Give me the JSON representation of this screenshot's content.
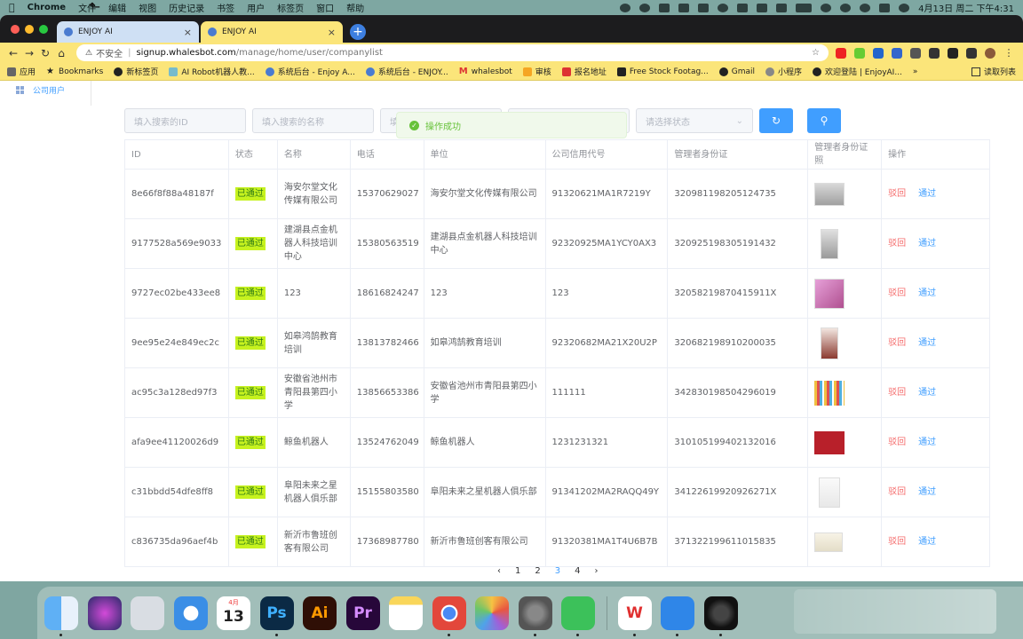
{
  "menubar": {
    "app": "Chrome",
    "items": [
      "文件",
      "编辑",
      "视图",
      "历史记录",
      "书签",
      "用户",
      "标签页",
      "窗口",
      "帮助"
    ],
    "clock": "4月13日 周二 下午4:31"
  },
  "tabs": [
    {
      "title": "ENJOY AI",
      "close": "×"
    },
    {
      "title": "ENJOY AI",
      "close": "×"
    }
  ],
  "newtab": "+",
  "address": {
    "insecure": "不安全",
    "separator": "|",
    "host": "signup.whalesbot.com",
    "path": "/manage/home/user/companylist"
  },
  "bookmarks": [
    "应用",
    "Bookmarks",
    "新标签页",
    "AI Robot机器人教...",
    "系统后台 - Enjoy A...",
    "系统后台 - ENJOY...",
    "whalesbot",
    "审核",
    "报名地址",
    "Free Stock Footag...",
    "Gmail",
    "小程序",
    "欢迎登陆 | EnjoyAI..."
  ],
  "bookmarks_more": "»",
  "reading_list": "读取列表",
  "sidebar": {
    "item": "公司用户"
  },
  "filters": {
    "id_placeholder": "填入搜索的ID",
    "name_placeholder": "填入搜索的名称",
    "third_placeholder": "填",
    "status_placeholder": "请选择状态"
  },
  "toast": {
    "message": "操作成功",
    "color": "#67c23a"
  },
  "table": {
    "headers": [
      "ID",
      "状态",
      "名称",
      "电话",
      "单位",
      "公司信用代号",
      "管理者身份证",
      "管理者身份证照",
      "操作"
    ],
    "rows": [
      {
        "id": "8e66f8f88a48187f",
        "status": "已通过",
        "name": "海安尔堂文化传媒有限公司",
        "phone": "15370629027",
        "unit": "海安尔堂文化传媒有限公司",
        "credit": "91320621MA1R7219Y",
        "idcard": "320981198205124735",
        "reject": "驳回",
        "pass": "通过"
      },
      {
        "id": "9177528a569e9033",
        "status": "已通过",
        "name": "建湖县点金机器人科技培训中心",
        "phone": "15380563519",
        "unit": "建湖县点金机器人科技培训中心",
        "credit": "92320925MA1YCY0AX3",
        "idcard": "320925198305191432",
        "reject": "驳回",
        "pass": "通过"
      },
      {
        "id": "9727ec02be433ee8",
        "status": "已通过",
        "name": "123",
        "phone": "18616824247",
        "unit": "123",
        "credit": "123",
        "idcard": "32058219870415911X",
        "reject": "驳回",
        "pass": "通过"
      },
      {
        "id": "9ee95e24e849ec2c",
        "status": "已通过",
        "name": "如皋鸿鹄教育培训",
        "phone": "13813782466",
        "unit": "如皋鸿鹄教育培训",
        "credit": "92320682MA21X20U2P",
        "idcard": "320682198910200035",
        "reject": "驳回",
        "pass": "通过"
      },
      {
        "id": "ac95c3a128ed97f3",
        "status": "已通过",
        "name": "安徽省池州市青阳县第四小学",
        "phone": "13856653386",
        "unit": "安徽省池州市青阳县第四小学",
        "credit": "111111",
        "idcard": "342830198504296019",
        "reject": "驳回",
        "pass": "通过"
      },
      {
        "id": "afa9ee41120026d9",
        "status": "已通过",
        "name": "鲸鱼机器人",
        "phone": "13524762049",
        "unit": "鲸鱼机器人",
        "credit": "1231231321",
        "idcard": "310105199402132016",
        "reject": "驳回",
        "pass": "通过"
      },
      {
        "id": "c31bbdd54dfe8ff8",
        "status": "已通过",
        "name": "阜阳未来之星机器人俱乐部",
        "phone": "15155803580",
        "unit": "阜阳未来之星机器人俱乐部",
        "credit": "91341202MA2RAQQ49Y",
        "idcard": "34122619920926271X",
        "reject": "驳回",
        "pass": "通过"
      },
      {
        "id": "c836735da96aef4b",
        "status": "已通过",
        "name": "新沂市鲁班创客有限公司",
        "phone": "17368987780",
        "unit": "新沂市鲁班创客有限公司",
        "credit": "91320381MA1T4U6B7B",
        "idcard": "371322199611015835",
        "reject": "驳回",
        "pass": "通过"
      }
    ]
  },
  "pagination": {
    "prev": "‹",
    "pages": [
      "1",
      "2",
      "3",
      "4"
    ],
    "current": "3",
    "next": "›"
  },
  "dock": {
    "calendar_month": "4月",
    "calendar_day": "13"
  }
}
